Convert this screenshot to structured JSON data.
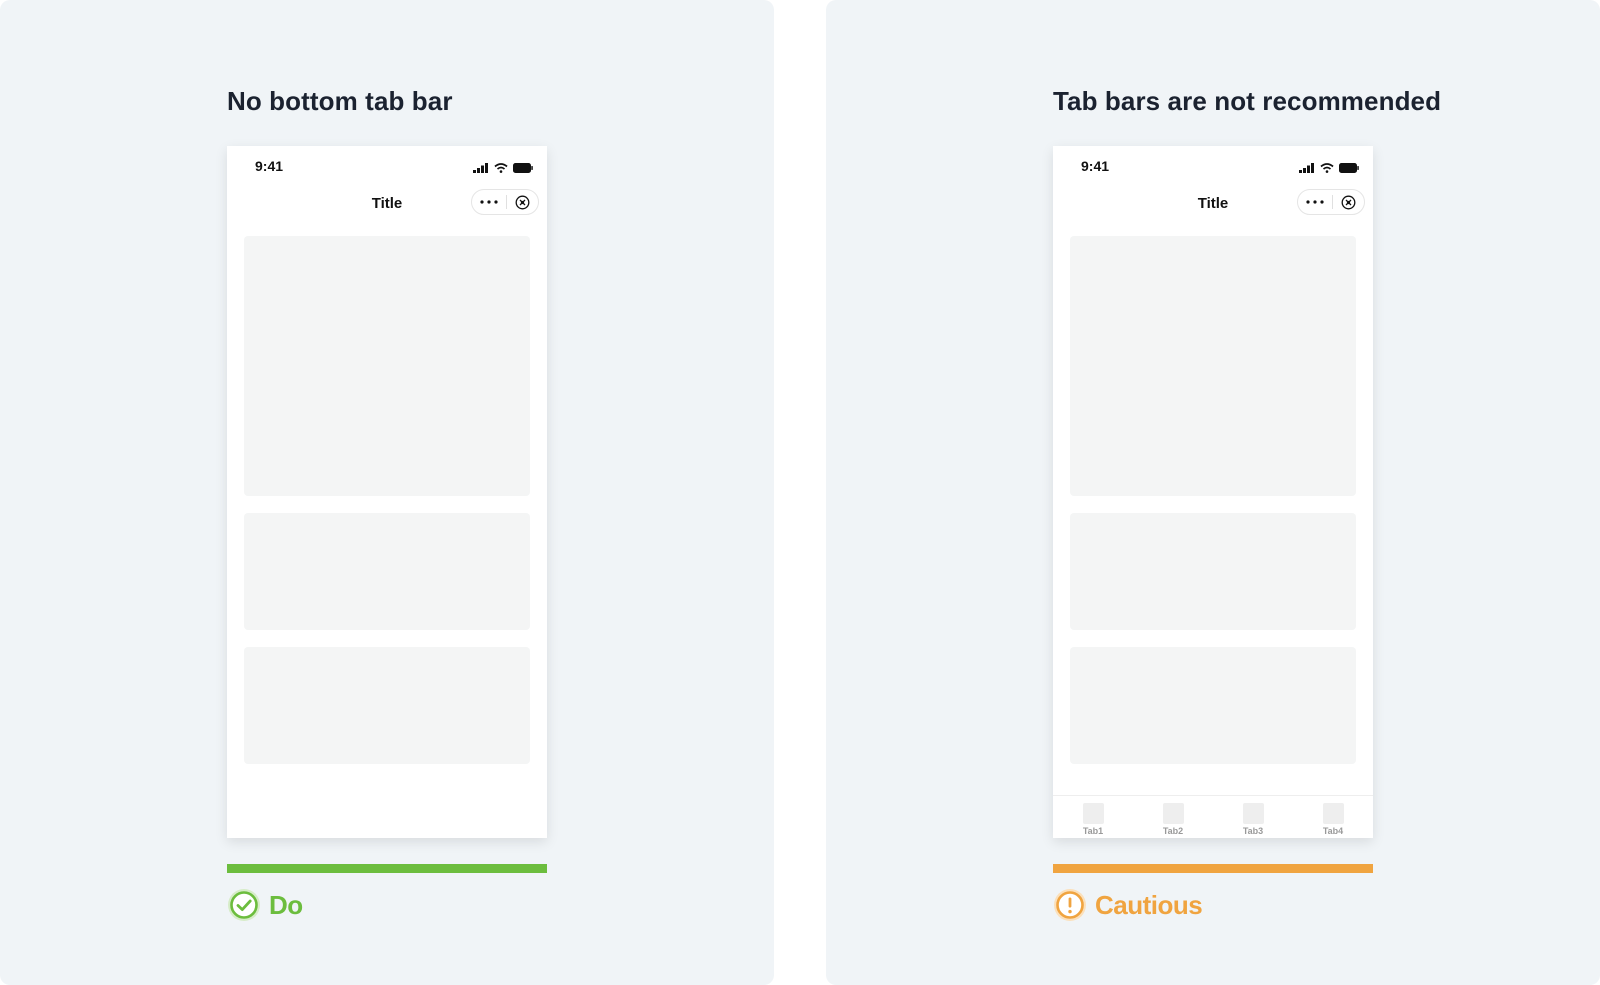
{
  "status_bar": {
    "time": "9:41"
  },
  "left_panel": {
    "heading": "No bottom tab bar",
    "nav_title": "Title",
    "verdict": {
      "label": "Do",
      "color": "#6cbd3e",
      "icon": "check-circle-icon"
    }
  },
  "right_panel": {
    "heading": "Tab bars are not recommended",
    "nav_title": "Title",
    "tabs": [
      {
        "label": "Tab1"
      },
      {
        "label": "Tab2"
      },
      {
        "label": "Tab3"
      },
      {
        "label": "Tab4"
      }
    ],
    "verdict": {
      "label": "Cautious",
      "color": "#f0a440",
      "icon": "exclamation-circle-icon"
    }
  },
  "colors": {
    "panel_background": "#f0f4f7",
    "placeholder_card": "#f4f5f5",
    "heading_text": "#1b2230"
  }
}
